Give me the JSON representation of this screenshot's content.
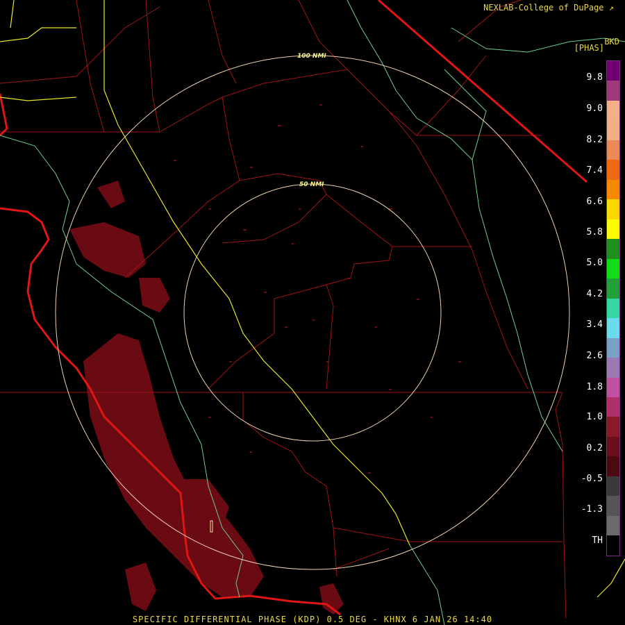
{
  "header": {
    "credit": "NEXLAB-College of DuPage",
    "credit_icon": "arrow-icon"
  },
  "legend": {
    "top_label": "BKD",
    "unit_label": "[PHAS]",
    "ticks": [
      "9.8",
      "9.0",
      "8.2",
      "7.4",
      "6.6",
      "5.8",
      "5.0",
      "4.2",
      "3.4",
      "2.6",
      "1.8",
      "1.0",
      "0.2",
      "-0.5",
      "-1.3",
      "TH"
    ],
    "colors": [
      "#700070",
      "#9e3b7c",
      "#f2b08a",
      "#f0b084",
      "#e98a58",
      "#ee6a12",
      "#f58a00",
      "#f9d800",
      "#fdfd00",
      "#1f8f1f",
      "#11dc18",
      "#22a03a",
      "#35d8a0",
      "#6bdcec",
      "#7aa0c8",
      "#9a7ab0",
      "#c050a0",
      "#b0306a",
      "#8a1a2a",
      "#6a0e1c",
      "#4a0a10",
      "#3a3a3a",
      "#555555",
      "#6a6a6a",
      "#000000"
    ]
  },
  "rings": {
    "inner_label": "50 NMI",
    "outer_label": "100 NMI"
  },
  "footer": {
    "caption": "SPECIFIC DIFFERENTIAL PHASE (KDP) 0.5 DEG - KHNX 6 JAN 26 14:40"
  }
}
